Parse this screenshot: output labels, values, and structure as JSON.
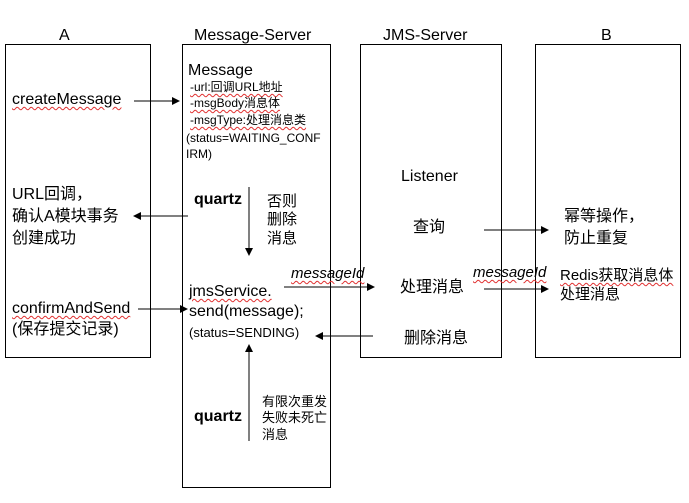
{
  "columns": {
    "a_title": "A",
    "message_server_title": "Message-Server",
    "jms_server_title": "JMS-Server",
    "b_title": "B"
  },
  "box_a": {
    "create_message": "createMessage",
    "url_callback_line1": "URL回调，",
    "url_callback_line2": "确认A模块事务",
    "url_callback_line3": "创建成功",
    "confirm_and_send": "confirmAndSend",
    "save_record": "(保存提交记录)"
  },
  "box_message_server": {
    "message_title": "Message",
    "field_url": "-url:回调URL地址",
    "field_body": "-msgBody消息体",
    "field_type": "-msgType:处理消息类",
    "status_waiting_line1": "(status=WAITING_CONF",
    "status_waiting_line2": "IRM)",
    "quartz_top": "quartz",
    "else_delete_line1": "否则",
    "else_delete_line2": "删除",
    "else_delete_line3": "消息",
    "jms_service_line1": "jmsService.",
    "jms_service_line2": "send(message);",
    "status_sending": "(status=SENDING)",
    "quartz_bottom": "quartz",
    "retry_line1": "有限次重发",
    "retry_line2": "失败未死亡",
    "retry_line3": "消息"
  },
  "box_jms": {
    "listener": "Listener",
    "query": "查询",
    "process": "处理消息",
    "delete": "删除消息"
  },
  "box_b": {
    "idempotent_line1": "幂等操作，",
    "idempotent_line2": "防止重复",
    "redis_line1": "Redis获取消息体",
    "redis_line2": "处理消息"
  },
  "edges": {
    "message_id_1": "messageId",
    "message_id_2": "messageId"
  },
  "colors": {
    "stroke": "#000000",
    "squiggle": "#e03030"
  }
}
